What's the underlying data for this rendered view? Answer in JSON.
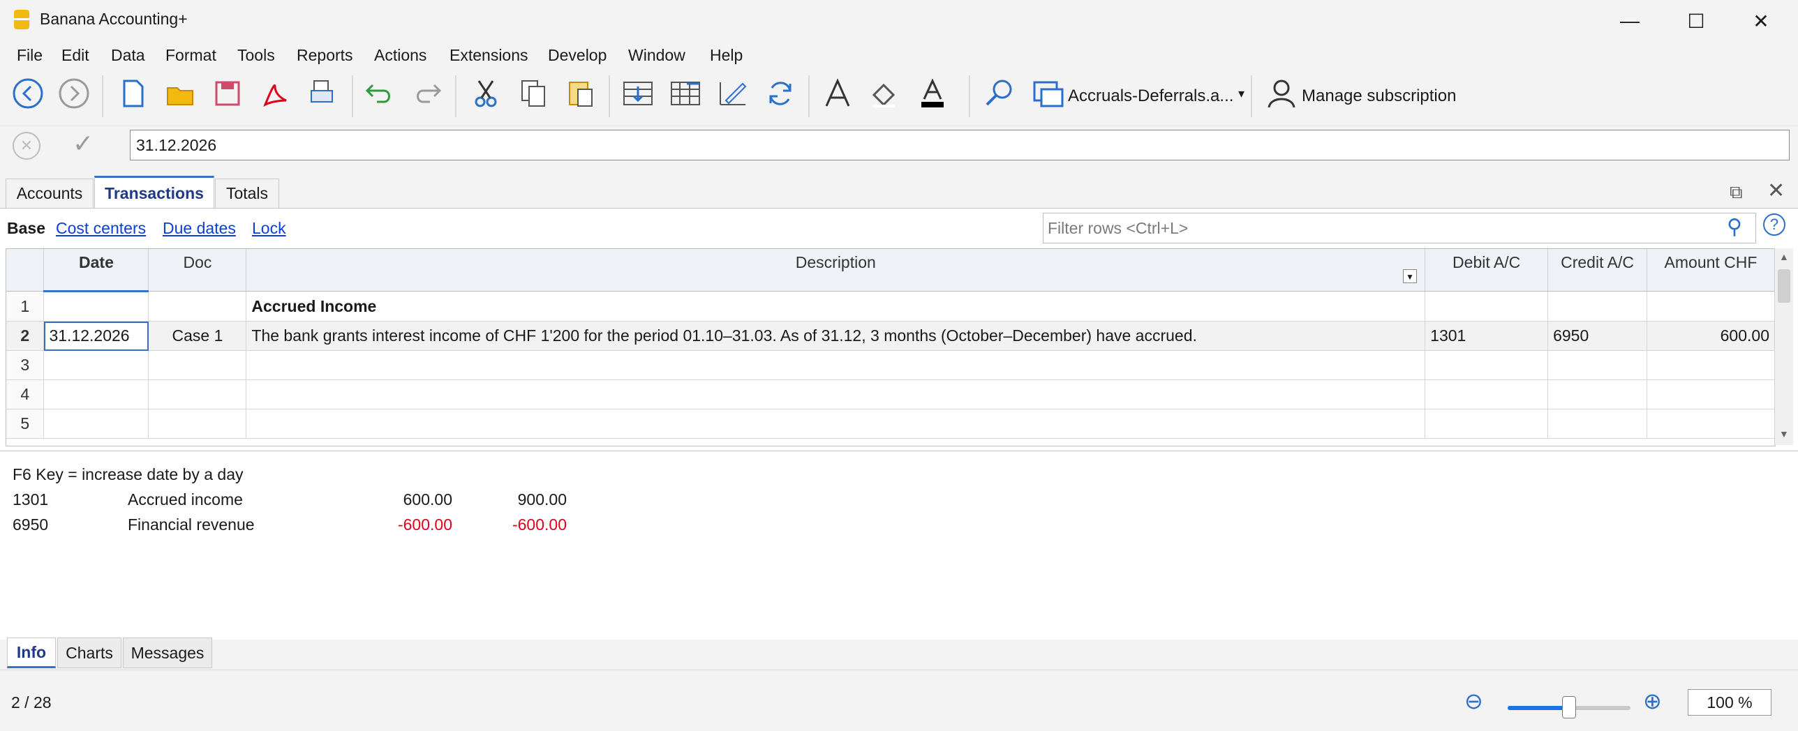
{
  "window": {
    "title": "Banana Accounting+"
  },
  "menu": [
    "File",
    "Edit",
    "Data",
    "Format",
    "Tools",
    "Reports",
    "Actions",
    "Extensions",
    "Develop",
    "Window",
    "Help"
  ],
  "toolbar": {
    "file_select": "Accruals-Deferrals.a...",
    "manage_subscription": "Manage subscription"
  },
  "edit_line": {
    "value": "31.12.2026"
  },
  "tabs": [
    "Accounts",
    "Transactions",
    "Totals"
  ],
  "views": {
    "base": "Base",
    "cost_centers": "Cost centers",
    "due_dates": "Due dates",
    "lock": "Lock"
  },
  "filter": {
    "placeholder": "Filter rows <Ctrl+L>"
  },
  "table": {
    "columns": [
      "",
      "Date",
      "Doc",
      "Description",
      "Debit A/C",
      "Credit A/C",
      "Amount CHF"
    ],
    "rows": [
      {
        "n": "1",
        "date": "",
        "doc": "",
        "desc": "Accrued Income",
        "debit": "",
        "credit": "",
        "amount": ""
      },
      {
        "n": "2",
        "date": "31.12.2026",
        "doc": "Case 1",
        "desc": "The bank grants interest income of CHF 1'200 for the period 01.10–31.03. As of 31.12, 3 months (October–December) have accrued.",
        "debit": "1301",
        "credit": "6950",
        "amount": "600.00"
      },
      {
        "n": "3",
        "date": "",
        "doc": "",
        "desc": "",
        "debit": "",
        "credit": "",
        "amount": ""
      },
      {
        "n": "4",
        "date": "",
        "doc": "",
        "desc": "",
        "debit": "",
        "credit": "",
        "amount": ""
      },
      {
        "n": "5",
        "date": "",
        "doc": "",
        "desc": "",
        "debit": "",
        "credit": "",
        "amount": ""
      }
    ]
  },
  "info": {
    "hint": "F6 Key = increase date by a day",
    "lines": [
      {
        "account": "1301",
        "name": "Accrued income",
        "amount": "600.00",
        "balance": "900.00"
      },
      {
        "account": "6950",
        "name": "Financial revenue",
        "amount": "-600.00",
        "balance": "-600.00"
      }
    ]
  },
  "bottom_tabs": [
    "Info",
    "Charts",
    "Messages"
  ],
  "status": {
    "position": "2 / 28",
    "zoom": "100 %",
    "zoom_fraction": 0.5
  },
  "colors": {
    "accent": "#3574c4",
    "negative": "#e0001b",
    "link": "#0b3fd6",
    "app_icon": "#f2b90f"
  }
}
